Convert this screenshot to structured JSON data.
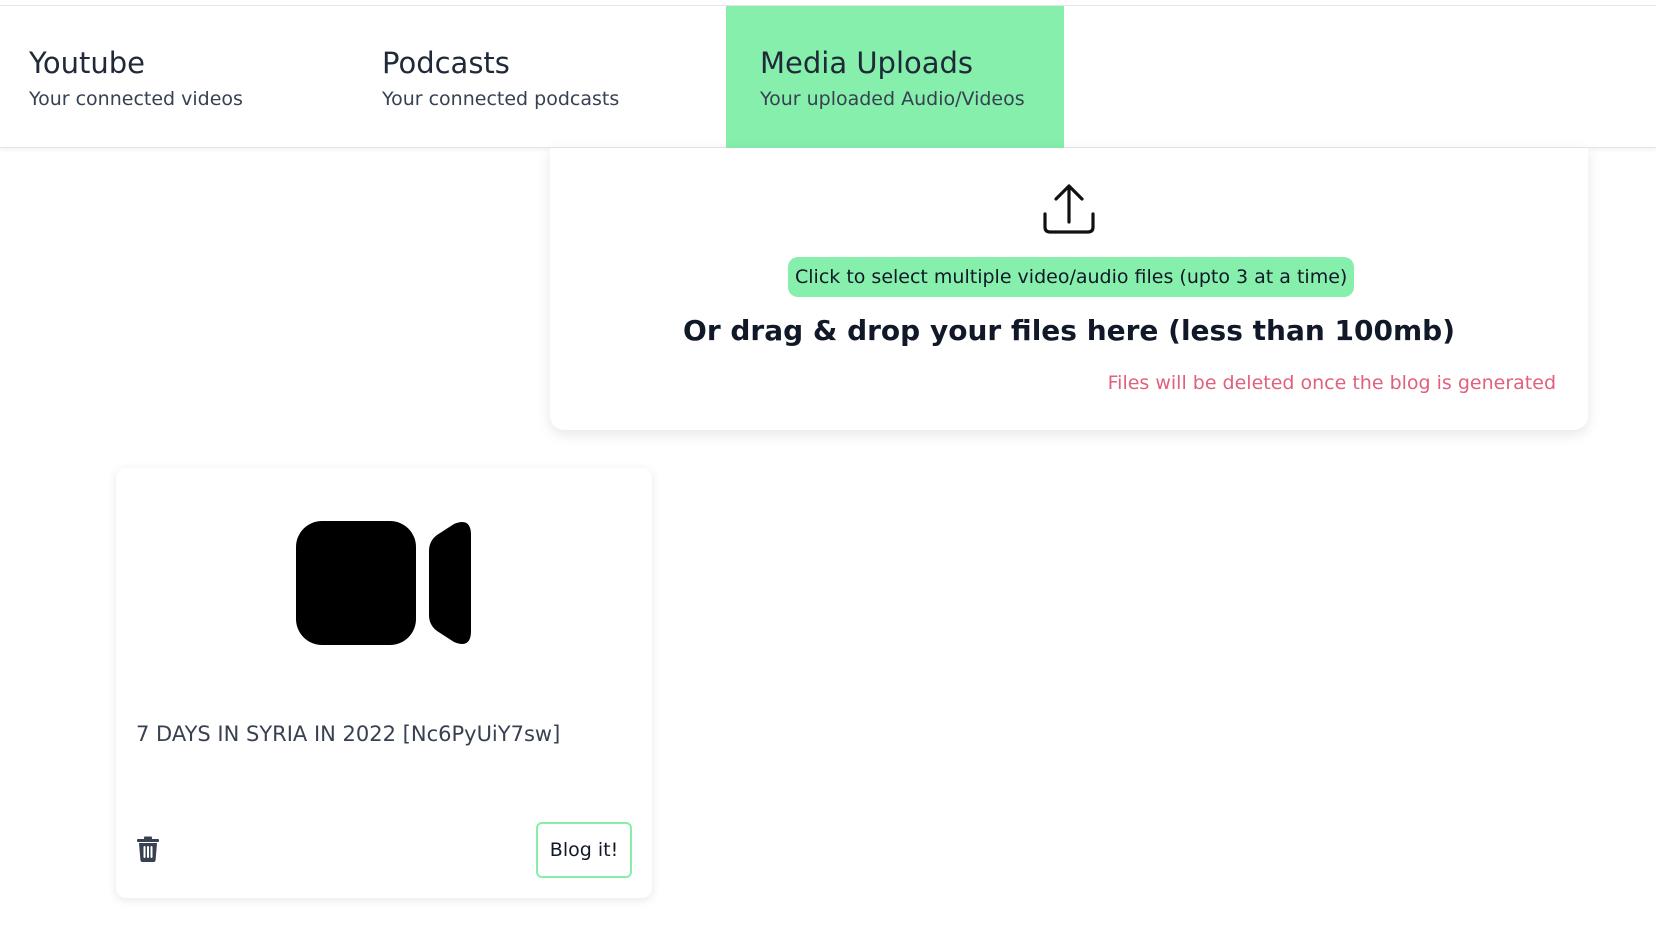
{
  "tabs": [
    {
      "title": "Youtube",
      "subtitle": "Your connected videos",
      "active": false
    },
    {
      "title": "Podcasts",
      "subtitle": "Your connected podcasts",
      "active": false
    },
    {
      "title": "Media Uploads",
      "subtitle": "Your uploaded Audio/Videos",
      "active": true
    }
  ],
  "upload": {
    "icon": "upload-icon",
    "select_label": "Click to select multiple video/audio files (upto 3 at a time)",
    "drag_text": "Or drag & drop your files here (less than 100mb)",
    "note": "Files will be deleted once the blog is generated"
  },
  "media_items": [
    {
      "icon": "video-camera-icon",
      "title": "7 DAYS IN SYRIA IN 2022 [Nc6PyUiY7sw]",
      "blog_label": "Blog it!"
    }
  ],
  "colors": {
    "accent": "#86efac",
    "note": "#e0607e",
    "text": "#1f2937"
  }
}
